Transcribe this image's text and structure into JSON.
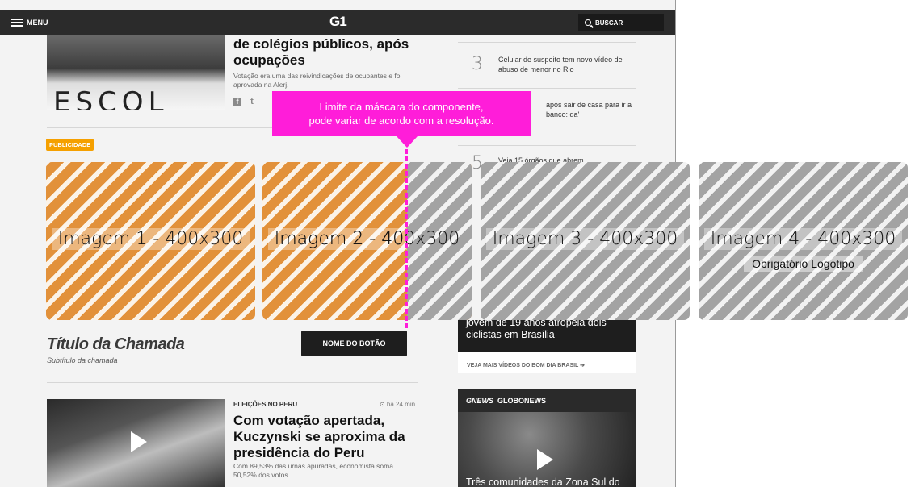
{
  "topbar": {
    "menu_label": "MENU",
    "logo": "G1",
    "search_label": "BUSCAR"
  },
  "story1": {
    "photo_banner_text": "ESCOL",
    "title": "de colégios públicos, após ocupações",
    "subtitle": "Votação era uma das reivindicações de ocupantes e foi aprovada na Alerj.",
    "social_facebook": "f",
    "social_twitter": "t"
  },
  "publicidade": "PUBLICIDADE",
  "right_list": [
    {
      "num": "3",
      "text": "Celular de suspeito tem novo vídeo de abuso de menor no Rio"
    },
    {
      "num": "",
      "text": "após sair de casa para ir a banco: da'"
    },
    {
      "num": "5",
      "text": "Veja 15 órgãos que abrem"
    }
  ],
  "carousel": {
    "images": [
      {
        "label": "Imagem 1 - 400x300",
        "sub": ""
      },
      {
        "label": "Imagem 2 - 400x300",
        "sub": ""
      },
      {
        "label": "Imagem 3 - 400x300",
        "sub": ""
      },
      {
        "label": "Imagem 4 - 400x300",
        "sub": "Obrigatório Logotipo"
      }
    ]
  },
  "callout": {
    "line1": "Limite da máscara do componente,",
    "line2": "pode variar de acordo com a resolução."
  },
  "chamada": {
    "title": "Título da Chamada",
    "subtitle": "Subtítulo da chamada",
    "button": "NOME DO BOTÃO"
  },
  "video_card": {
    "caption": "jovem de 19 anos atropela dois ciclistas em Brasília",
    "link": "VEJA MAIS VÍDEOS DO BOM DIA BRASIL ➔"
  },
  "story2": {
    "kicker": "ELEIÇÕES NO PERU",
    "time": "⊙ há 24 min",
    "title": "Com votação apertada, Kuczynski se aproxima da presidência do Peru",
    "subtitle": "Com 89,53% das urnas apuradas, economista soma 50,52% dos votos."
  },
  "globonews": {
    "brand": "GNEWS",
    "label": "GLOBONEWS",
    "caption": "Três comunidades da Zona Sul do"
  },
  "colors": {
    "accent": "#ff1dd9",
    "badge": "#f5a000",
    "orange_stripe": "#e2913a",
    "gray_stripe": "#a3a3a3"
  }
}
